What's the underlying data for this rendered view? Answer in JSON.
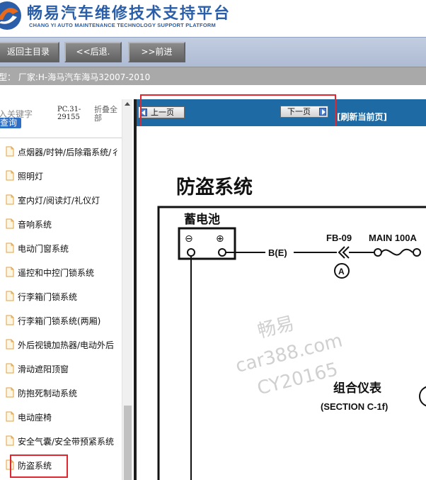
{
  "header": {
    "logo_icon": "car-logo-icon",
    "brand_cn": "畅易汽车维修技术支持平台",
    "brand_en": "CHANG YI AUTO MAINTENANCE TECHNOLOGY SUPPORT PLATFORM"
  },
  "nav": {
    "home": "返回主目录",
    "back": "<<后退.",
    "forward": ">>前进"
  },
  "vehicle": {
    "text": "型：  厂家:H-海马汽车海马32007-2010"
  },
  "sidebar": {
    "search_placeholder": "入关键字",
    "query_label": "查询",
    "pc_code": "PC.31-29155",
    "collapse_all": "折叠全部",
    "items": [
      {
        "label": "点烟器/时钟/后除霜系统/彳"
      },
      {
        "label": "照明灯"
      },
      {
        "label": "室内灯/阅读灯/礼仪灯"
      },
      {
        "label": "音响系统"
      },
      {
        "label": "电动门窗系统"
      },
      {
        "label": "遥控和中控门锁系统"
      },
      {
        "label": "行李箱门锁系统"
      },
      {
        "label": "行李箱门锁系统(两厢)"
      },
      {
        "label": "外后视镜加热器/电动外后"
      },
      {
        "label": "滑动遮阳顶窗"
      },
      {
        "label": "防抱死制动系统"
      },
      {
        "label": "电动座椅"
      },
      {
        "label": "安全气囊/安全带预紧系统"
      },
      {
        "label": "防盗系统",
        "selected": true
      }
    ]
  },
  "content": {
    "prev_page": "上一页",
    "next_page": "下一页",
    "refresh": "[刷新当前页]"
  },
  "diagram": {
    "title": "防盗系统",
    "battery_label": "蓄电池",
    "neg_symbol": "⊖",
    "pos_symbol": "⊕",
    "wire_code": "B(E)",
    "fuse_block": "FB-09",
    "main_fuse": "MAIN 100A",
    "connector_mark": "A",
    "meter_label": "组合仪表",
    "meter_section": "(SECTION C-1f)",
    "watermark_lines": [
      "畅易",
      "car388.com",
      "CY20165"
    ]
  },
  "colors": {
    "brand_blue": "#2a5ea8",
    "toolbar_blue": "#1e6aa5",
    "highlight_red": "#e0262f"
  }
}
